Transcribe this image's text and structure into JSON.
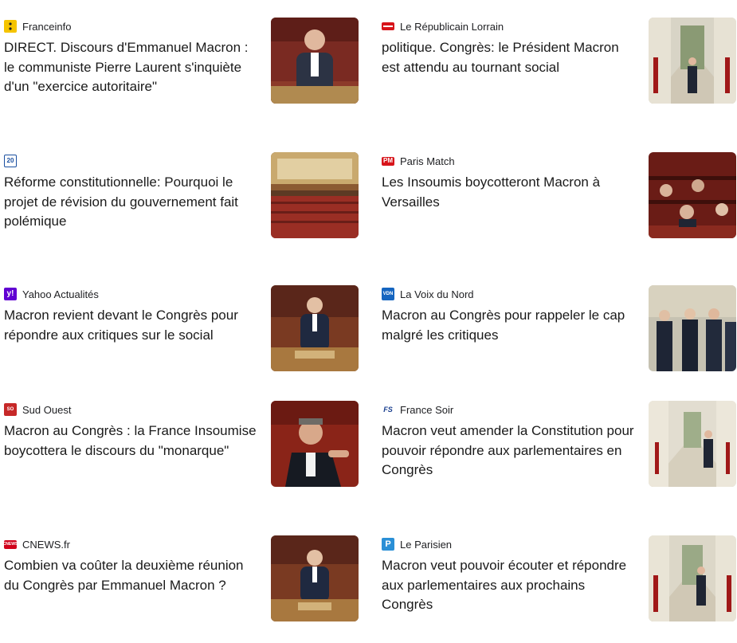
{
  "cards": [
    {
      "source": "Franceinfo",
      "headline": "DIRECT. Discours d'Emmanuel Macron : le communiste Pierre Laurent s'inquiète d'un \"exercice autoritaire\"",
      "logo_icon": "franceinfo-logo-icon",
      "logo_color": "#f5c400",
      "thumb_icon": "speaker-at-podium-photo"
    },
    {
      "source": "Le Républicain Lorrain",
      "headline": "politique. Congrès: le Président Macron est attendu au tournant social",
      "logo_icon": "republicain-lorrain-logo-icon",
      "logo_color": "#d7141a",
      "thumb_icon": "gallery-walk-photo"
    },
    {
      "source": "20 Minutes",
      "headline": "Réforme constitutionnelle: Pourquoi le projet de révision du gouvernement fait polémique",
      "logo_icon": "20-minutes-logo-icon",
      "logo_color": "#1a4fa0",
      "thumb_icon": "assembly-hemicycle-photo"
    },
    {
      "source": "Paris Match",
      "headline": "Les Insoumis boycotteront Macron à Versailles",
      "logo_icon": "paris-match-logo-icon",
      "logo_color": "#d7141a",
      "thumb_icon": "deputies-seated-photo"
    },
    {
      "source": "Yahoo Actualités",
      "headline": "Macron revient devant le Congrès pour répondre aux critiques sur le social",
      "logo_icon": "yahoo-logo-icon",
      "logo_color": "#6001d2",
      "thumb_icon": "speaker-at-podium-photo"
    },
    {
      "source": "La Voix du Nord",
      "headline": "Macron au Congrès pour rappeler le cap malgré les critiques",
      "logo_icon": "la-voix-du-nord-logo-icon",
      "logo_color": "#1565c0",
      "thumb_icon": "officials-walking-photo"
    },
    {
      "source": "Sud Ouest",
      "headline": "Macron au Congrès : la France Insoumise boycottera le discours du \"monarque\"",
      "logo_icon": "sud-ouest-logo-icon",
      "logo_color": "#c62828",
      "thumb_icon": "pointing-deputy-photo"
    },
    {
      "source": "France Soir",
      "headline": "Macron veut amender la Constitution pour pouvoir répondre aux parlementaires en Congrès",
      "logo_icon": "france-soir-logo-icon",
      "logo_color": "#1a3f8f",
      "thumb_icon": "gallery-walk-photo"
    },
    {
      "source": "CNEWS.fr",
      "headline": "Combien va coûter la deuxième réunion du Congrès par Emmanuel Macron ?",
      "logo_icon": "cnews-logo-icon",
      "logo_color": "#d0021b",
      "thumb_icon": "speaker-at-podium-photo"
    },
    {
      "source": "Le Parisien",
      "headline": "Macron veut pouvoir écouter et répondre aux parlementaires aux prochains Congrès",
      "logo_icon": "le-parisien-logo-icon",
      "logo_color": "#2a8fd6",
      "thumb_icon": "gallery-walk-photo"
    }
  ]
}
